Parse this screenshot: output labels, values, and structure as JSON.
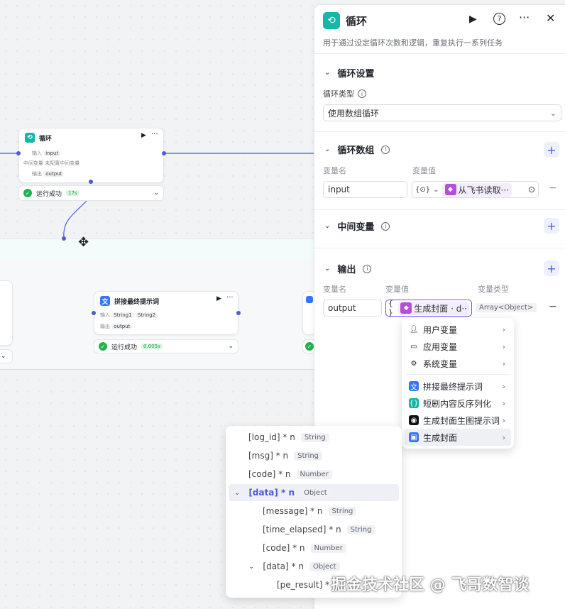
{
  "canvas": {
    "loop_node": {
      "title": "循环",
      "row1_label": "输入",
      "row1_value": "input",
      "row2_label": "中间变量",
      "row2_value": "未配置中间变量",
      "row3_label": "输出",
      "row3_value": "output",
      "status": "运行成功",
      "time": "17s"
    },
    "concat_node": {
      "title": "拼接最终提示词",
      "row1_label": "输入",
      "row1_v1": "String1",
      "row1_v2": "String2",
      "row2_label": "输出",
      "row2_value": "output",
      "status": "运行成功",
      "time": "0.005s"
    }
  },
  "panel": {
    "title": "循环",
    "description": "用于通过设定循环次数和逻辑，重复执行一系列任务",
    "loop_settings": {
      "title": "循环设置",
      "type_label": "循环类型",
      "type_value": "使用数组循环"
    },
    "loop_array": {
      "title": "循环数组",
      "col_name": "变量名",
      "col_value": "变量值",
      "name": "input",
      "ref": "从飞书读取···"
    },
    "middle_var": {
      "title": "中间变量"
    },
    "output": {
      "title": "输出",
      "col_name": "变量名",
      "col_value": "变量值",
      "col_type": "变量类型",
      "name": "output",
      "ref": "生成封面 · d··",
      "type": "Array<Object>"
    }
  },
  "menu": {
    "items": [
      {
        "label": "用户变量",
        "icon": "user-icon"
      },
      {
        "label": "应用变量",
        "icon": "folder-icon"
      },
      {
        "label": "系统变量",
        "icon": "gear-icon"
      },
      {
        "label": "拼接最终提示词",
        "icon": "text-node-icon"
      },
      {
        "label": "短剧内容反序列化",
        "icon": "code-node-icon"
      },
      {
        "label": "生成封面生图提示词",
        "icon": "llm-node-icon"
      },
      {
        "label": "生成封面",
        "icon": "image-node-icon"
      }
    ]
  },
  "tree": {
    "rows": [
      {
        "label": "[log_id] * n",
        "type": "String"
      },
      {
        "label": "[msg] * n",
        "type": "String"
      },
      {
        "label": "[code] * n",
        "type": "Number"
      },
      {
        "label": "[data] * n",
        "type": "Object"
      },
      {
        "label": "[message] * n",
        "type": "String"
      },
      {
        "label": "[time_elapsed] * n",
        "type": "String"
      },
      {
        "label": "[code] * n",
        "type": "Number"
      },
      {
        "label": "[data] * n",
        "type": "Object"
      },
      {
        "label": "[pe_result] * n",
        "type": ""
      }
    ]
  },
  "watermark": "掘金技术社区 @ 飞哥数智谈"
}
